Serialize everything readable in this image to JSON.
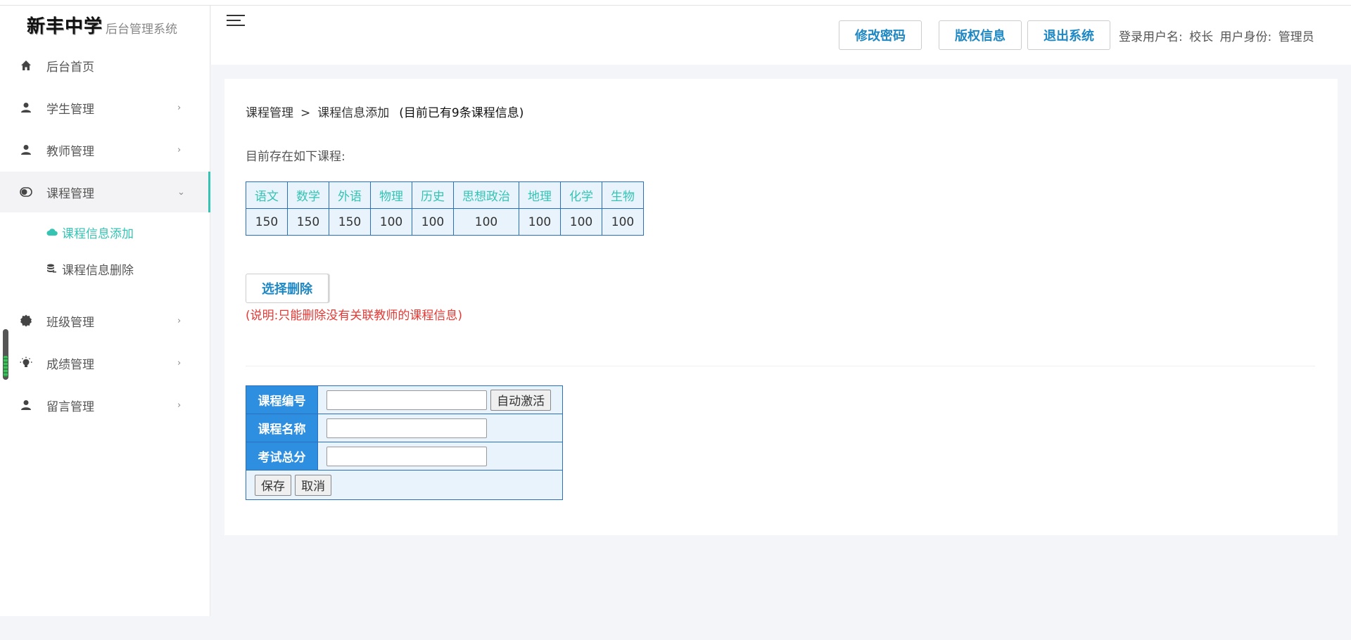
{
  "brand": {
    "school": "新丰中学",
    "subtitle": "后台管理系统"
  },
  "sidebar": {
    "items": [
      {
        "label": "后台首页",
        "icon": "home-icon"
      },
      {
        "label": "学生管理",
        "icon": "user-icon",
        "chevron": "›"
      },
      {
        "label": "教师管理",
        "icon": "user-icon",
        "chevron": "›"
      },
      {
        "label": "课程管理",
        "icon": "toggle-icon",
        "chevron": "⌄",
        "active": true
      },
      {
        "label": "班级管理",
        "icon": "gear-icon",
        "chevron": "›"
      },
      {
        "label": "成绩管理",
        "icon": "bulb-icon",
        "chevron": "›"
      },
      {
        "label": "留言管理",
        "icon": "user-icon",
        "chevron": "›"
      }
    ],
    "sub_items": [
      {
        "label": "课程信息添加",
        "icon": "cloud-icon",
        "active": true
      },
      {
        "label": "课程信息删除",
        "icon": "database-icon"
      }
    ]
  },
  "header": {
    "buttons": {
      "change_password": "修改密码",
      "copyright": "版权信息",
      "logout": "退出系统"
    },
    "user": {
      "name_label": "登录用户名:",
      "name": "校长",
      "role_label": "用户身份:",
      "role": "管理员"
    }
  },
  "main": {
    "breadcrumb": {
      "section": "课程管理",
      "sep": ">",
      "page": "课程信息添加",
      "count_text": "(目前已有9条课程信息)"
    },
    "exist_label": "目前存在如下课程:",
    "courses": {
      "names": [
        "语文",
        "数学",
        "外语",
        "物理",
        "历史",
        "思想政治",
        "地理",
        "化学",
        "生物"
      ],
      "scores": [
        "150",
        "150",
        "150",
        "100",
        "100",
        "100",
        "100",
        "100",
        "100"
      ]
    },
    "delete_button": "选择删除",
    "note": "(说明:只能删除没有关联教师的课程信息)",
    "form": {
      "course_id_label": "课程编号",
      "course_id_value": "",
      "auto_button": "自动激活",
      "course_name_label": "课程名称",
      "course_name_value": "",
      "total_score_label": "考试总分",
      "total_score_value": "",
      "save_button": "保存",
      "cancel_button": "取消"
    }
  },
  "colors": {
    "accent": "#35c3b4",
    "link": "#1e88c4",
    "form_label_bg": "#2e8fe0",
    "border": "#2a6fbf",
    "warning": "#e53935"
  }
}
